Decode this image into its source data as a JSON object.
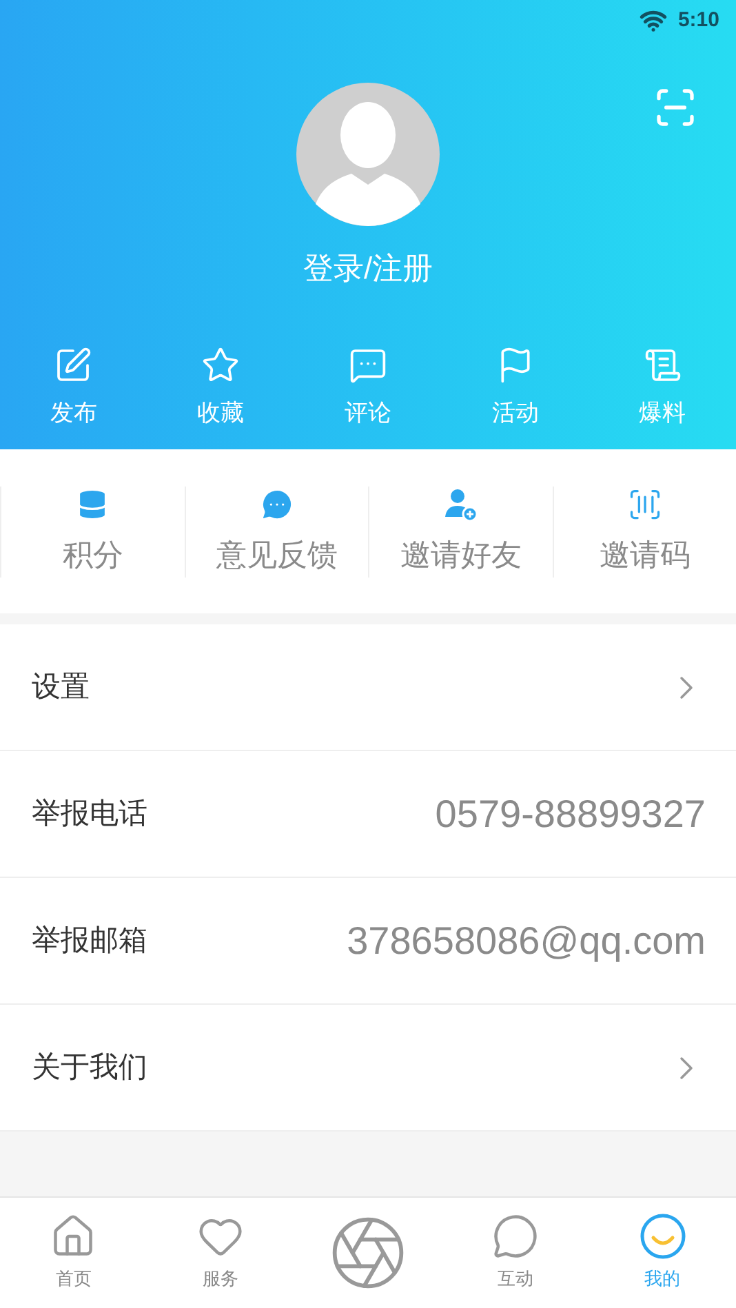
{
  "status_bar": {
    "time": "5:10"
  },
  "profile": {
    "login": "登录/注册"
  },
  "actions": [
    {
      "label": "发布"
    },
    {
      "label": "收藏"
    },
    {
      "label": "评论"
    },
    {
      "label": "活动"
    },
    {
      "label": "爆料"
    }
  ],
  "shortcuts": [
    {
      "label": "积分"
    },
    {
      "label": "意见反馈"
    },
    {
      "label": "邀请好友"
    },
    {
      "label": "邀请码"
    }
  ],
  "menu": [
    {
      "kind": "link",
      "label": "设置"
    },
    {
      "kind": "value",
      "label": "举报电话",
      "value": "0579-88899327"
    },
    {
      "kind": "value",
      "label": "举报邮箱",
      "value": "378658086@qq.com"
    },
    {
      "kind": "link",
      "label": "关于我们"
    }
  ],
  "tabs": [
    {
      "kind": "tab",
      "label": "首页",
      "selected": false
    },
    {
      "kind": "tab",
      "label": "服务",
      "selected": false
    },
    {
      "kind": "camera"
    },
    {
      "kind": "tab",
      "label": "互动",
      "selected": false
    },
    {
      "kind": "tab",
      "label": "我的",
      "selected": true
    }
  ]
}
